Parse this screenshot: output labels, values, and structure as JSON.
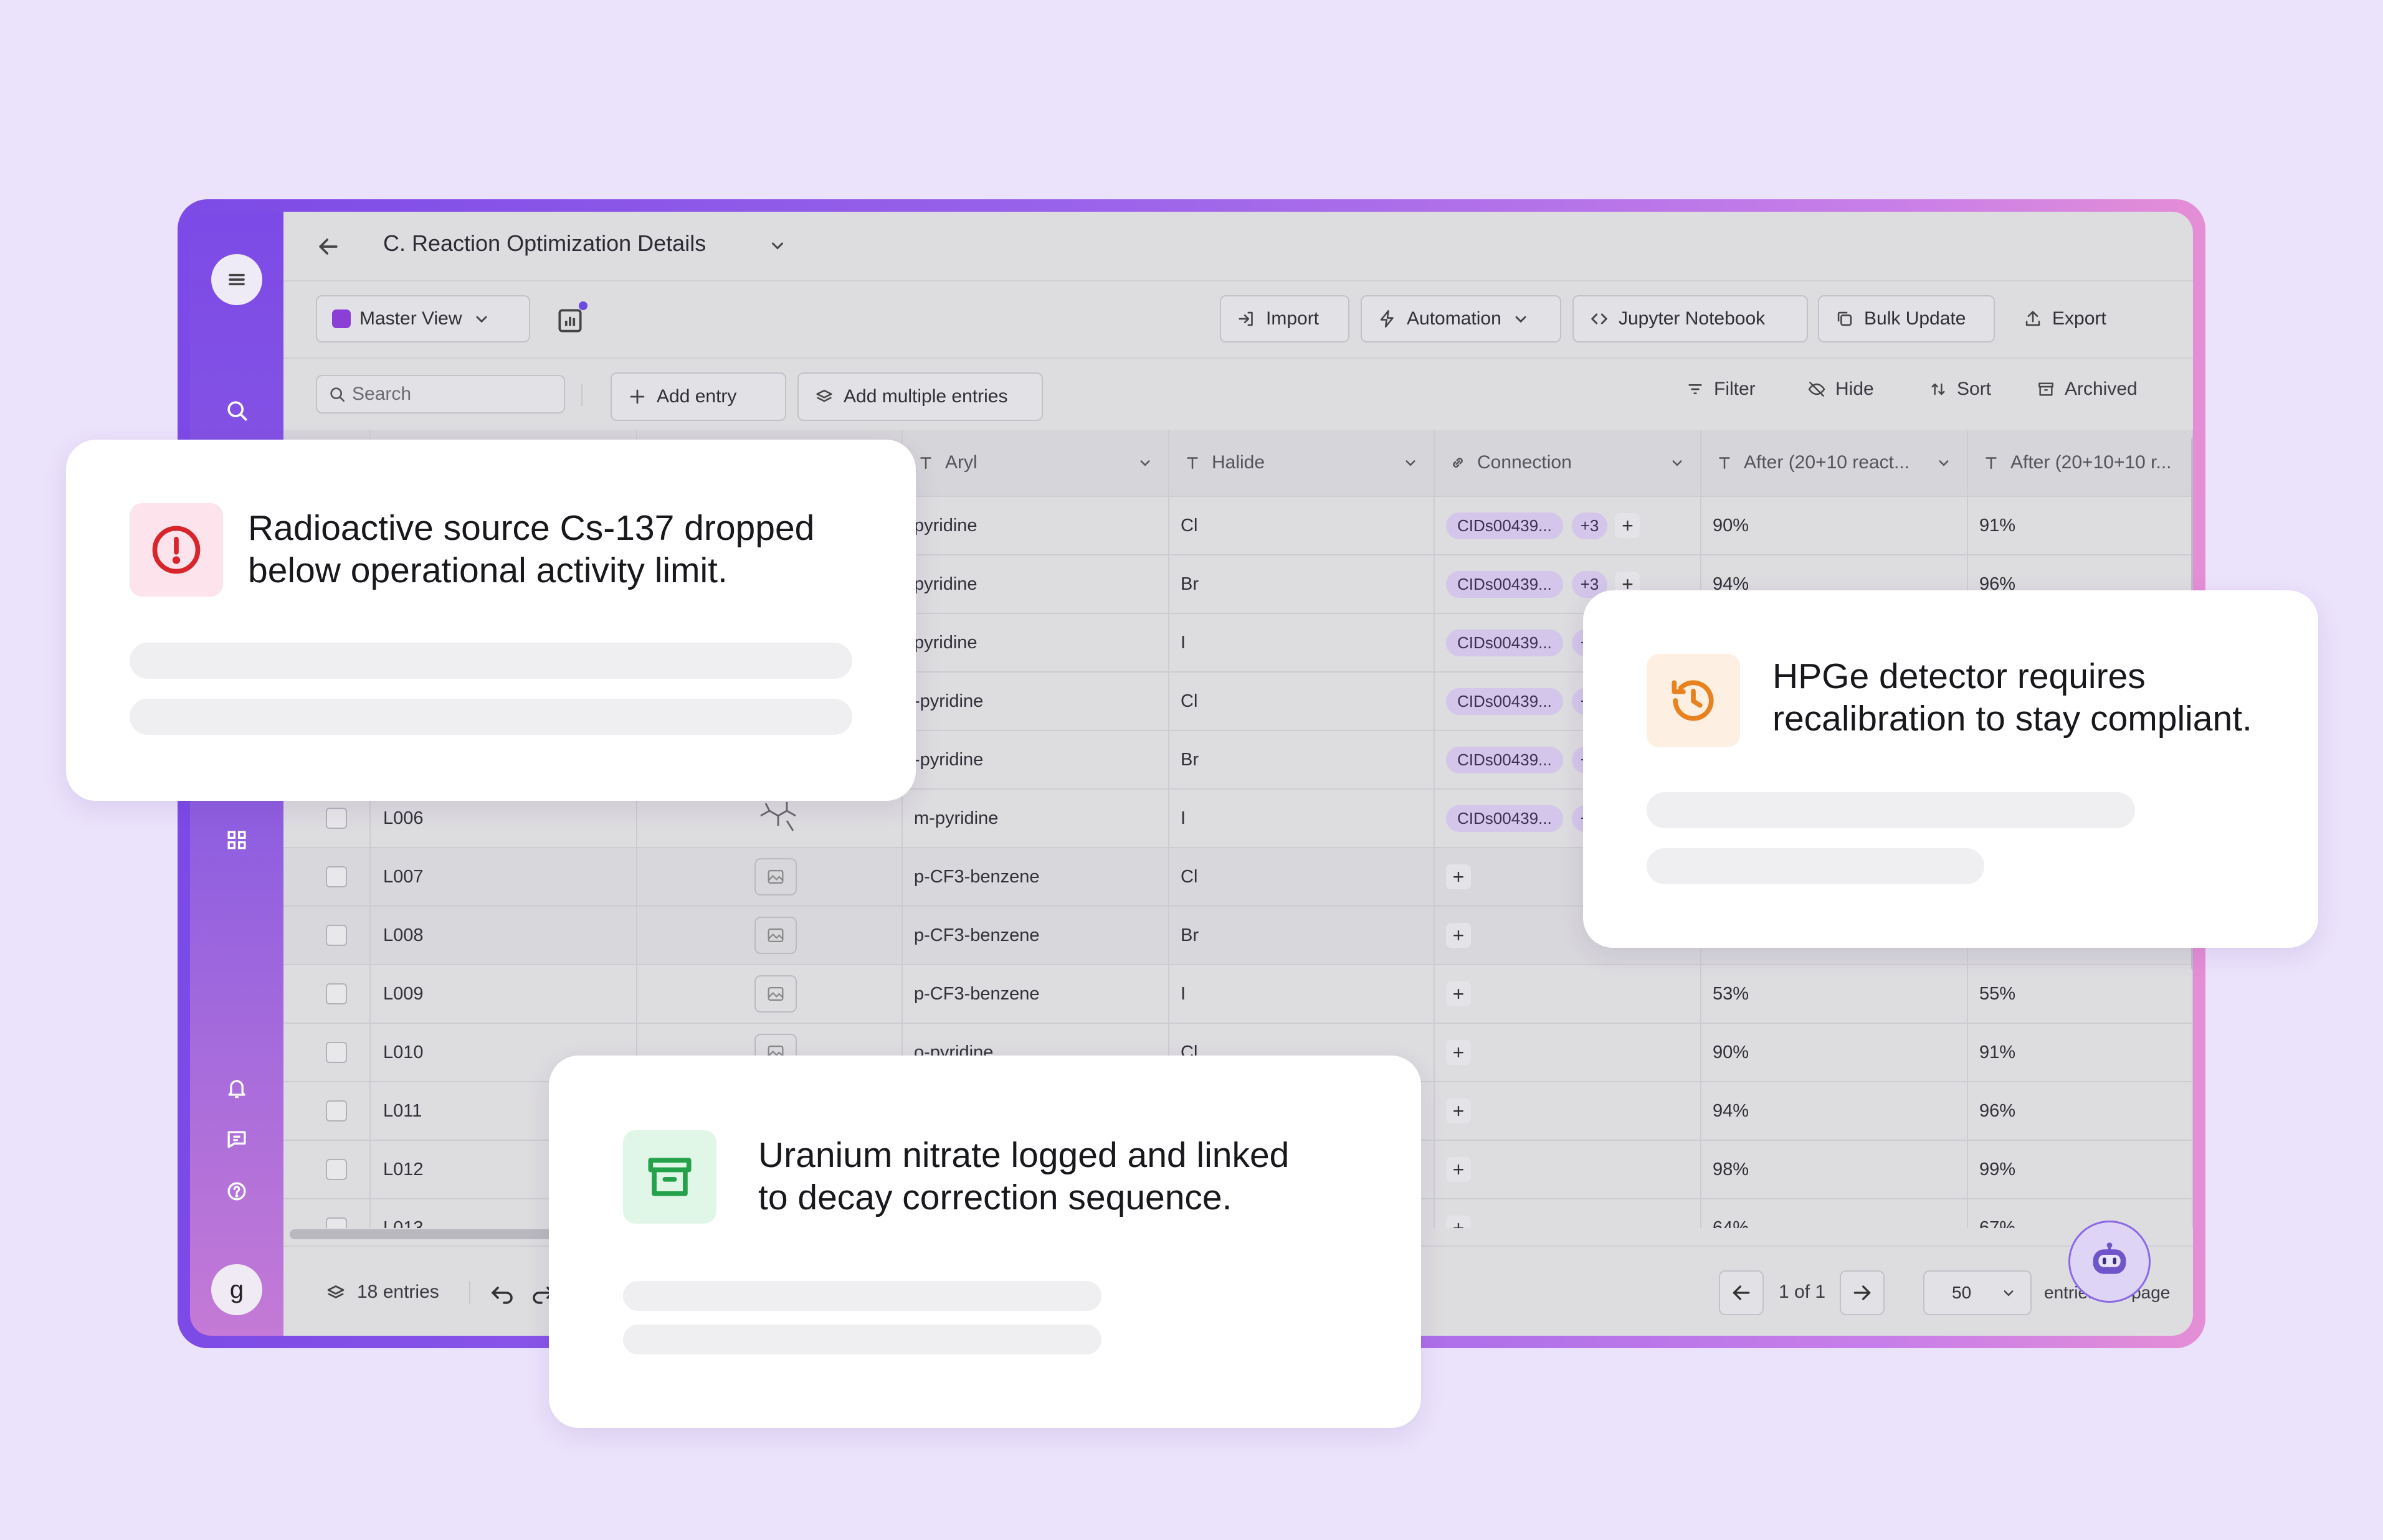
{
  "header": {
    "title": "C. Reaction Optimization Details"
  },
  "toolbar": {
    "view_label": "Master View",
    "import_label": "Import",
    "automation_label": "Automation",
    "jupyter_label": "Jupyter Notebook",
    "bulk_update_label": "Bulk Update",
    "export_label": "Export"
  },
  "filterbar": {
    "search_placeholder": "Search",
    "add_entry_label": "Add entry",
    "add_multiple_label": "Add multiple entries",
    "filter_label": "Filter",
    "hide_label": "Hide",
    "sort_label": "Sort",
    "archived_label": "Archived"
  },
  "table": {
    "columns": [
      {
        "label": "Aryl"
      },
      {
        "label": "Halide"
      },
      {
        "label": "Connection"
      },
      {
        "label": "After (20+10 react..."
      },
      {
        "label": "After (20+10+10 r..."
      }
    ],
    "rows": [
      {
        "id": "",
        "aryl": "pyridine",
        "halide": "Cl",
        "connection": "CIDs00439...",
        "more": "+3",
        "after1": "90%",
        "after2": "91%"
      },
      {
        "id": "",
        "aryl": "pyridine",
        "halide": "Br",
        "connection": "CIDs00439...",
        "more": "+3",
        "after1": "94%",
        "after2": "96%"
      },
      {
        "id": "",
        "aryl": "pyridine",
        "halide": "I",
        "connection": "CIDs00439...",
        "more": "+",
        "after1": "",
        "after2": ""
      },
      {
        "id": "",
        "aryl": "-pyridine",
        "halide": "Cl",
        "connection": "CIDs00439...",
        "more": "+",
        "after1": "",
        "after2": ""
      },
      {
        "id": "",
        "aryl": "-pyridine",
        "halide": "Br",
        "connection": "CIDs00439...",
        "more": "+",
        "after1": "",
        "after2": ""
      },
      {
        "id": "L006",
        "aryl": "m-pyridine",
        "halide": "I",
        "connection": "CIDs00439...",
        "more": "+",
        "after1": "",
        "after2": ""
      },
      {
        "id": "L007",
        "aryl": "p-CF3-benzene",
        "halide": "Cl",
        "connection": "",
        "more": "",
        "after1": "",
        "after2": ""
      },
      {
        "id": "L008",
        "aryl": "p-CF3-benzene",
        "halide": "Br",
        "connection": "",
        "more": "",
        "after1": "",
        "after2": ""
      },
      {
        "id": "L009",
        "aryl": "p-CF3-benzene",
        "halide": "I",
        "connection": "",
        "more": "",
        "after1": "53%",
        "after2": "55%"
      },
      {
        "id": "L010",
        "aryl": "o-pyridine",
        "halide": "Cl",
        "connection": "",
        "more": "",
        "after1": "90%",
        "after2": "91%"
      },
      {
        "id": "L011",
        "aryl": "",
        "halide": "",
        "connection": "",
        "more": "",
        "after1": "94%",
        "after2": "96%"
      },
      {
        "id": "L012",
        "aryl": "",
        "halide": "",
        "connection": "",
        "more": "",
        "after1": "98%",
        "after2": "99%"
      },
      {
        "id": "L013",
        "aryl": "",
        "halide": "",
        "connection": "",
        "more": "",
        "after1": "64%",
        "after2": "67%"
      }
    ]
  },
  "footer": {
    "entries_label": "18 entries",
    "page_label": "1 of 1",
    "per_page_value": "50",
    "per_page_label": "entries per page"
  },
  "sidebar": {
    "avatar_letter": "g"
  },
  "notifications": {
    "alert": {
      "line1": "Radioactive source Cs-137 dropped",
      "line2": "below operational activity limit."
    },
    "calibration": {
      "line1": "HPGe detector requires",
      "line2": "recalibration to stay compliant."
    },
    "archive": {
      "line1": "Uranium nitrate logged and linked",
      "line2": "to decay correction sequence."
    }
  },
  "colors": {
    "background": "#ebe2fc",
    "frame_start": "#7c4ae6",
    "frame_end": "#e58ed6",
    "alert_red": "#d6262b",
    "history_orange": "#e8821f",
    "archive_green": "#23a24a",
    "chip": "#d3c6ea"
  },
  "icons": [
    "menu-icon",
    "search-icon",
    "grid-icon",
    "bell-icon",
    "chat-icon",
    "help-icon",
    "back-arrow-icon",
    "chevron-down-icon",
    "chart-icon",
    "import-icon",
    "bolt-icon",
    "code-icon",
    "copy-icon",
    "upload-icon",
    "plus-icon",
    "layers-icon",
    "filter-icon",
    "eye-off-icon",
    "sort-icon",
    "archive-icon",
    "text-type-icon",
    "link-icon",
    "image-icon",
    "undo-icon",
    "redo-icon",
    "arrow-left-icon",
    "arrow-right-icon",
    "robot-icon",
    "alert-circle-icon",
    "history-icon"
  ]
}
